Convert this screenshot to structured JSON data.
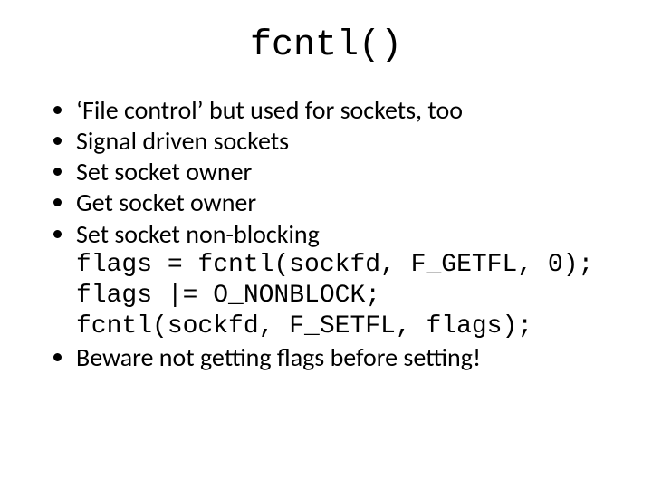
{
  "title": "fcntl()",
  "bullets": {
    "b0": "‘File control’ but used for sockets, too",
    "b1": "Signal driven sockets",
    "b2": "Set socket owner",
    "b3": "Get socket owner",
    "b4": "Set socket non-blocking"
  },
  "code": {
    "l0": "flags = fcntl(sockfd, F_GETFL, 0);",
    "l1": "flags |= O_NONBLOCK;",
    "l2": "fcntl(sockfd, F_SETFL, flags);"
  },
  "bullets2": {
    "b0": "Beware not getting flags before setting!"
  }
}
